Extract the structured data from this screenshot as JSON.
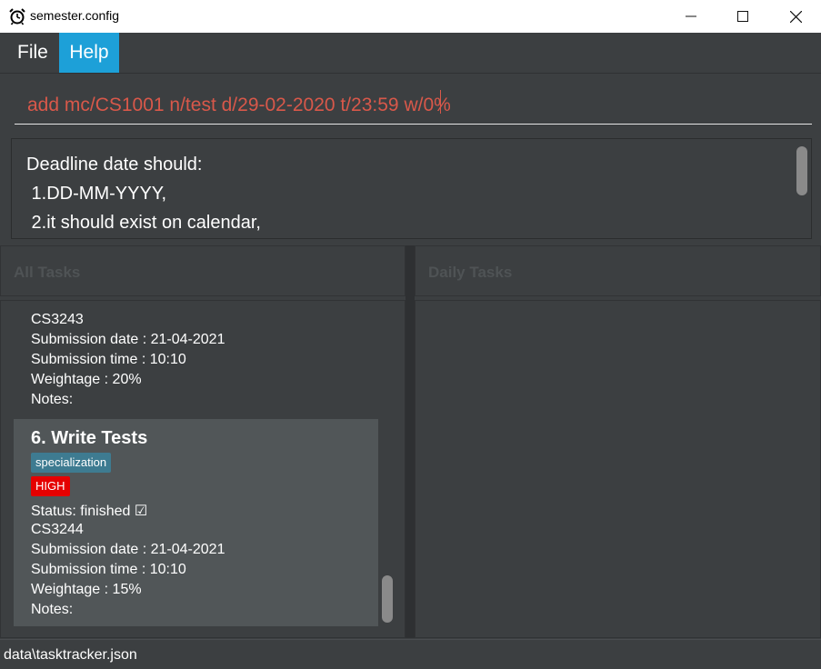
{
  "window": {
    "title": "semester.config",
    "minimize": "—",
    "maximize": "☐",
    "close": "✕"
  },
  "menu": {
    "file": "File",
    "help": "Help"
  },
  "command": {
    "value": "add mc/CS1001 n/test d/29-02-2020 t/23:59 w/0%"
  },
  "result": {
    "text": "Deadline date should:\n 1.DD-MM-YYYY,\n 2.it should exist on calendar,"
  },
  "panels": {
    "all_tasks": "All Tasks",
    "daily_tasks": "Daily Tasks"
  },
  "tasks": [
    {
      "module": "CS3243",
      "submission_date": "Submission date : 21-04-2021",
      "submission_time": "Submission time : 10:10",
      "weightage": "Weightage : 20%",
      "notes": "Notes:"
    },
    {
      "title": "6.  Write Tests",
      "tag": "specialization",
      "priority": "HIGH",
      "status": "Status: finished ☑",
      "module": "CS3244",
      "submission_date": "Submission date : 21-04-2021",
      "submission_time": "Submission time : 10:10",
      "weightage": "Weightage : 15%",
      "notes": "Notes:"
    }
  ],
  "status_bar": {
    "path": "data\\tasktracker.json"
  },
  "colors": {
    "accent": "#1da0d8",
    "error_text": "#d8584a",
    "priority_high": "#e50000",
    "tag": "#3e7b91"
  }
}
